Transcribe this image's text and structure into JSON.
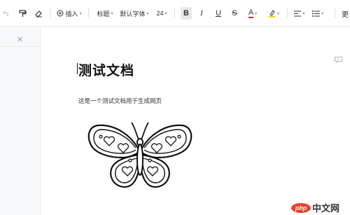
{
  "toolbar": {
    "insert_label": "插入",
    "heading_label": "标题",
    "font_family": "默认字体",
    "font_size": "24",
    "bold_glyph": "B",
    "italic_glyph": "I",
    "underline_glyph": "U",
    "strike_glyph": "S",
    "font_color_glyph": "A",
    "font_color": "#e02020",
    "highlight_color": "#f5d300",
    "more_glyph": "更"
  },
  "document": {
    "title": "测试文档",
    "body": "这是一个测试文档用于生成网页"
  },
  "watermark": {
    "logo": "php",
    "text": "中文网"
  }
}
